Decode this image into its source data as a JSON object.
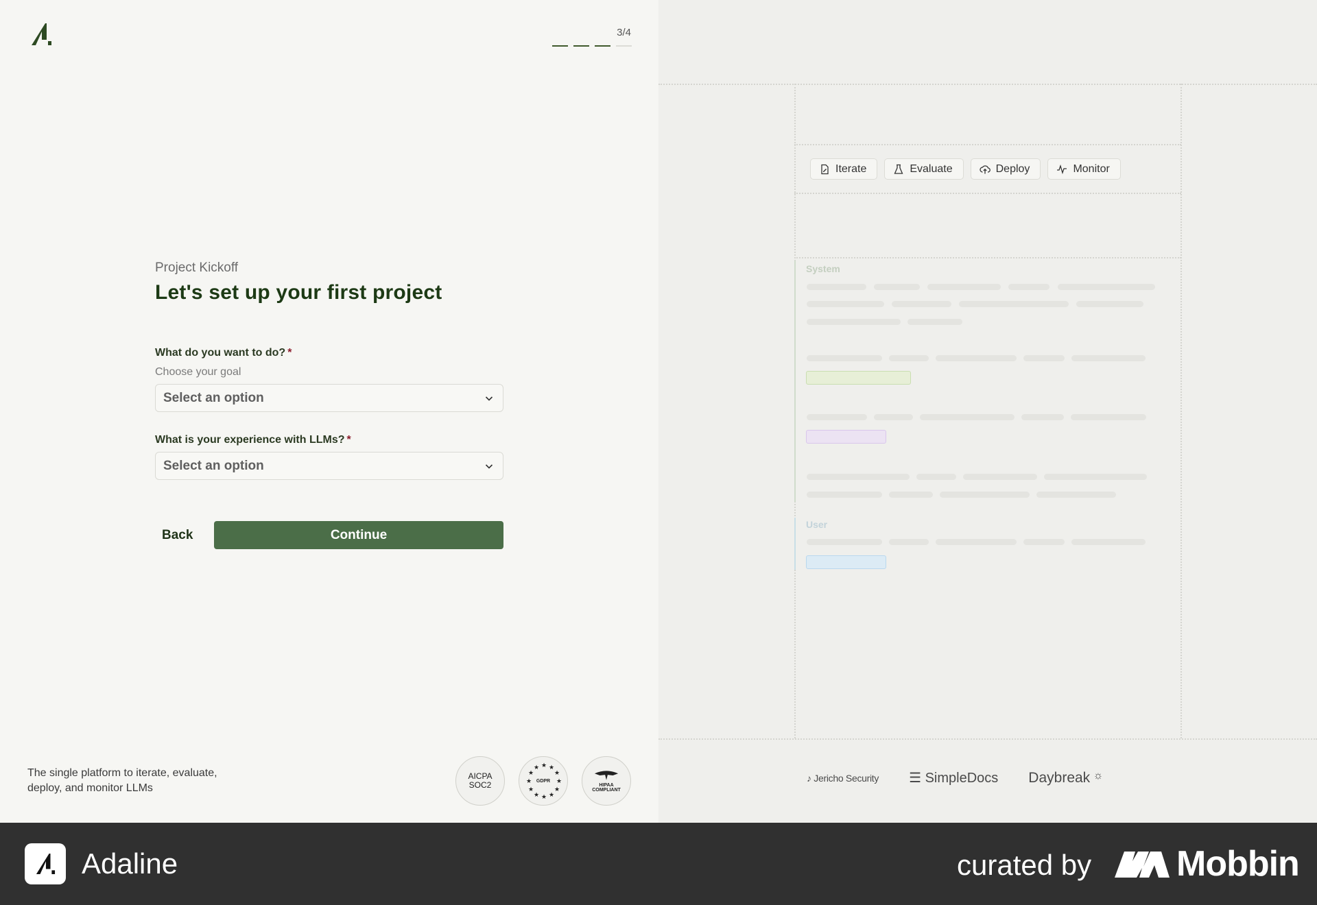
{
  "header": {
    "progress_text": "3/4",
    "progress_step": 3,
    "progress_total": 4
  },
  "form": {
    "eyebrow": "Project Kickoff",
    "title": "Let's set up your first project",
    "q1": {
      "label": "What do you want to do?",
      "required_mark": "*",
      "sublabel": "Choose your goal",
      "placeholder": "Select an option"
    },
    "q2": {
      "label": "What is your experience with LLMs?",
      "required_mark": "*",
      "placeholder": "Select an option"
    },
    "back_label": "Back",
    "continue_label": "Continue"
  },
  "footer_left": {
    "tagline": "The single platform to iterate, evaluate, deploy, and monitor LLMs",
    "badges": [
      {
        "line1": "AICPA",
        "line2": "SOC2",
        "icon": "soc2-badge"
      },
      {
        "text": "GDPR",
        "icon": "gdpr-stars-badge"
      },
      {
        "line1": "HIPAA",
        "line2": "COMPLIANT",
        "icon": "hipaa-eagle-badge"
      }
    ]
  },
  "preview": {
    "tabs": [
      {
        "label": "Iterate",
        "icon": "file-edit-icon"
      },
      {
        "label": "Evaluate",
        "icon": "flask-icon"
      },
      {
        "label": "Deploy",
        "icon": "cloud-upload-icon"
      },
      {
        "label": "Monitor",
        "icon": "activity-icon"
      }
    ],
    "system_label": "System",
    "user_label": "User"
  },
  "customer_logos": [
    "Jericho Security",
    "SimpleDocs",
    "Daybreak"
  ],
  "footer": {
    "app_name": "Adaline",
    "curated_by": "curated by",
    "brand": "Mobbin"
  },
  "colors": {
    "primary": "#4b6e48",
    "title": "#1d3a15",
    "required": "#8b1d2c",
    "footer_bg": "#303030"
  }
}
